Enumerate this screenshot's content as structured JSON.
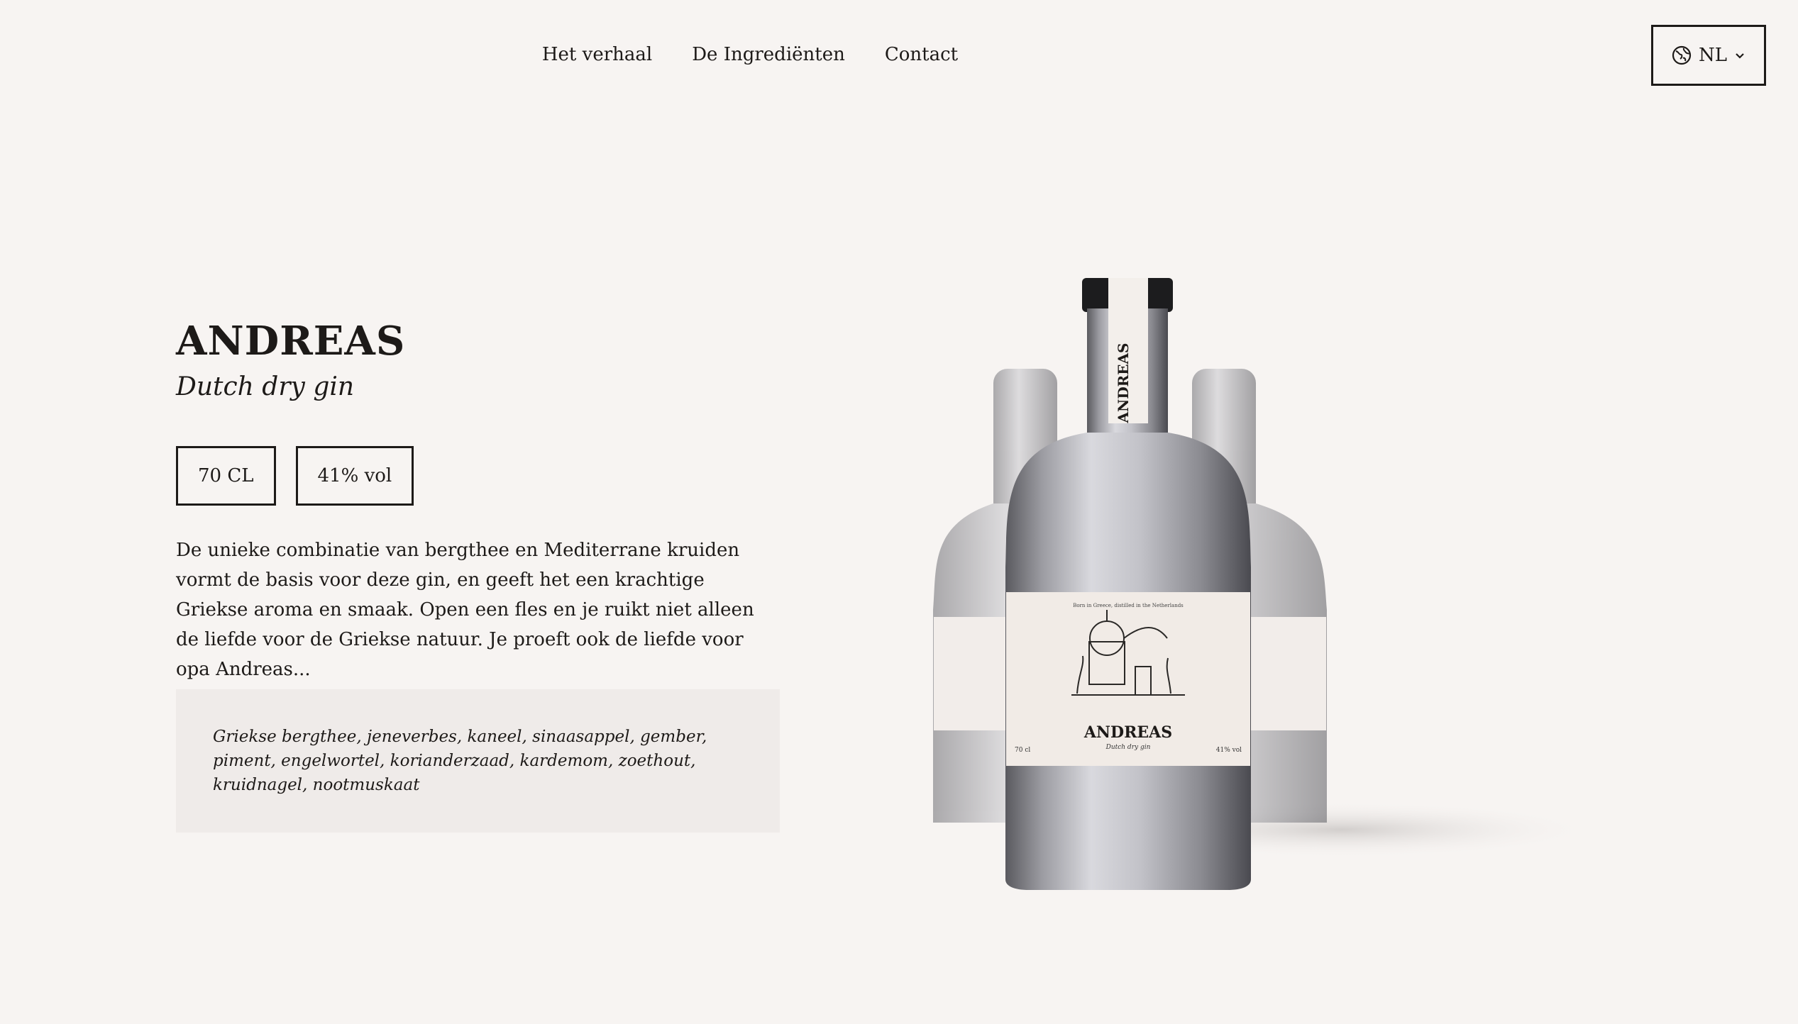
{
  "nav": {
    "items": [
      {
        "label": "Het verhaal"
      },
      {
        "label": "De Ingrediënten"
      },
      {
        "label": "Contact"
      }
    ]
  },
  "language": {
    "selected": "NL",
    "icon": "globe-icon"
  },
  "product": {
    "title": "ANDREAS",
    "subtitle": "Dutch dry gin",
    "badges": [
      {
        "label": "70 CL"
      },
      {
        "label": "41% vol"
      }
    ],
    "description": "De unieke combinatie van bergthee en Mediterrane kruiden vormt de basis voor deze gin, en geeft het een krachtige Griekse aroma en smaak. Open een fles en je ruikt niet alleen de liefde voor de Griekse natuur. Je proeft ook de liefde voor opa Andreas...",
    "ingredients": "Griekse bergthee, jeneverbes, kaneel, sinaasappel, gember, piment, engelwortel, korianderzaad, kardemom, zoethout, kruidnagel, nootmuskaat"
  },
  "bottle": {
    "neck_label": "ANDREAS",
    "label_name": "ANDREAS",
    "label_sub": "Dutch dry gin",
    "label_top": "Born in Greece, distilled in the Netherlands",
    "label_volume": "70 cl",
    "label_abv": "41% vol"
  }
}
